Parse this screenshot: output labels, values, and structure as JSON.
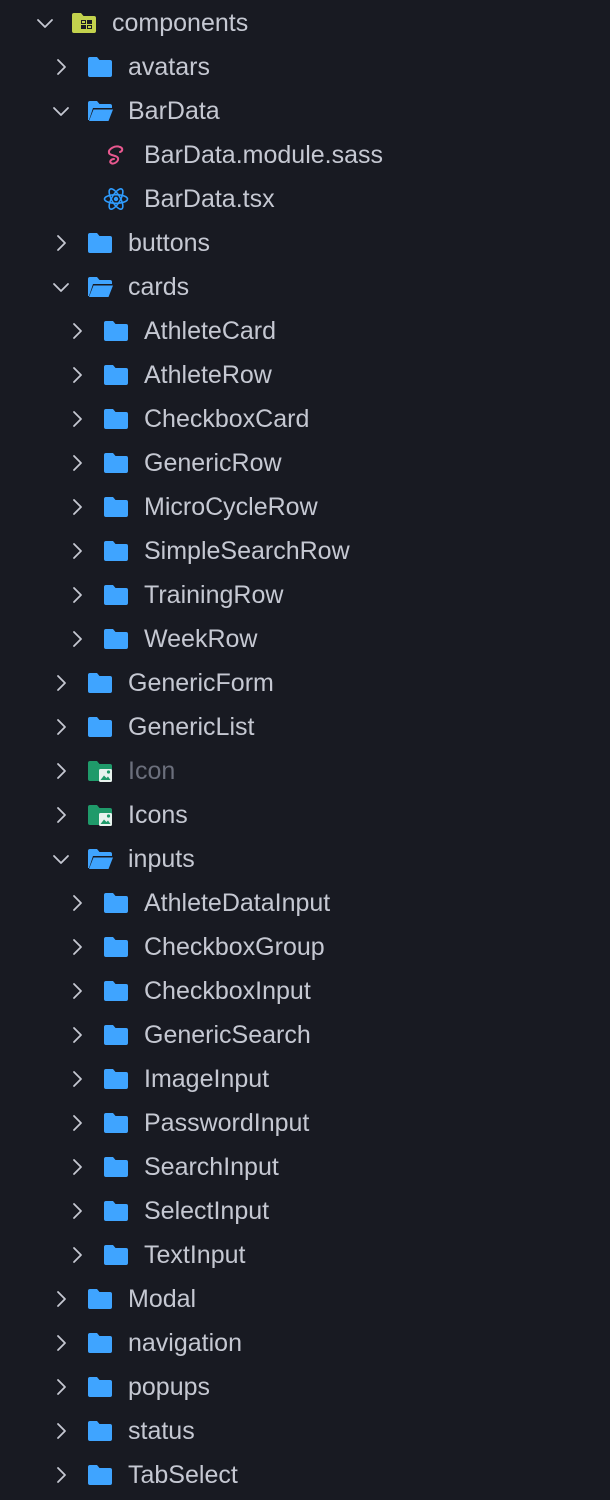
{
  "colors": {
    "background": "#181a22",
    "text": "#c5c8d2",
    "text_dimmed": "#6b6f7c",
    "chevron": "#c5c8d2",
    "folder": "#3fa4ff",
    "root_folder": "#c3d24d",
    "sass": "#e8588f",
    "react": "#2e9cff",
    "image_folder": "#1f9a6a"
  },
  "explorer": {
    "items": [
      {
        "label": "components",
        "depth": 0,
        "expanded": true,
        "icon": "root-folder-open-icon"
      },
      {
        "label": "avatars",
        "depth": 1,
        "expanded": false,
        "icon": "folder-icon"
      },
      {
        "label": "BarData",
        "depth": 1,
        "expanded": true,
        "icon": "folder-open-icon"
      },
      {
        "label": "BarData.module.sass",
        "depth": 2,
        "file": true,
        "icon": "sass-file-icon"
      },
      {
        "label": "BarData.tsx",
        "depth": 2,
        "file": true,
        "icon": "react-file-icon"
      },
      {
        "label": "buttons",
        "depth": 1,
        "expanded": false,
        "icon": "folder-icon"
      },
      {
        "label": "cards",
        "depth": 1,
        "expanded": true,
        "icon": "folder-open-icon"
      },
      {
        "label": "AthleteCard",
        "depth": 2,
        "expanded": false,
        "icon": "folder-icon"
      },
      {
        "label": "AthleteRow",
        "depth": 2,
        "expanded": false,
        "icon": "folder-icon"
      },
      {
        "label": "CheckboxCard",
        "depth": 2,
        "expanded": false,
        "icon": "folder-icon"
      },
      {
        "label": "GenericRow",
        "depth": 2,
        "expanded": false,
        "icon": "folder-icon"
      },
      {
        "label": "MicroCycleRow",
        "depth": 2,
        "expanded": false,
        "icon": "folder-icon"
      },
      {
        "label": "SimpleSearchRow",
        "depth": 2,
        "expanded": false,
        "icon": "folder-icon"
      },
      {
        "label": "TrainingRow",
        "depth": 2,
        "expanded": false,
        "icon": "folder-icon"
      },
      {
        "label": "WeekRow",
        "depth": 2,
        "expanded": false,
        "icon": "folder-icon"
      },
      {
        "label": "GenericForm",
        "depth": 1,
        "expanded": false,
        "icon": "folder-icon"
      },
      {
        "label": "GenericList",
        "depth": 1,
        "expanded": false,
        "icon": "folder-icon"
      },
      {
        "label": "Icon",
        "depth": 1,
        "expanded": false,
        "icon": "image-folder-icon",
        "dimmed": true
      },
      {
        "label": "Icons",
        "depth": 1,
        "expanded": false,
        "icon": "image-folder-icon"
      },
      {
        "label": "inputs",
        "depth": 1,
        "expanded": true,
        "icon": "folder-open-icon"
      },
      {
        "label": "AthleteDataInput",
        "depth": 2,
        "expanded": false,
        "icon": "folder-icon"
      },
      {
        "label": "CheckboxGroup",
        "depth": 2,
        "expanded": false,
        "icon": "folder-icon"
      },
      {
        "label": "CheckboxInput",
        "depth": 2,
        "expanded": false,
        "icon": "folder-icon"
      },
      {
        "label": "GenericSearch",
        "depth": 2,
        "expanded": false,
        "icon": "folder-icon"
      },
      {
        "label": "ImageInput",
        "depth": 2,
        "expanded": false,
        "icon": "folder-icon"
      },
      {
        "label": "PasswordInput",
        "depth": 2,
        "expanded": false,
        "icon": "folder-icon"
      },
      {
        "label": "SearchInput",
        "depth": 2,
        "expanded": false,
        "icon": "folder-icon"
      },
      {
        "label": "SelectInput",
        "depth": 2,
        "expanded": false,
        "icon": "folder-icon"
      },
      {
        "label": "TextInput",
        "depth": 2,
        "expanded": false,
        "icon": "folder-icon"
      },
      {
        "label": "Modal",
        "depth": 1,
        "expanded": false,
        "icon": "folder-icon"
      },
      {
        "label": "navigation",
        "depth": 1,
        "expanded": false,
        "icon": "folder-icon"
      },
      {
        "label": "popups",
        "depth": 1,
        "expanded": false,
        "icon": "folder-icon"
      },
      {
        "label": "status",
        "depth": 1,
        "expanded": false,
        "icon": "folder-icon"
      },
      {
        "label": "TabSelect",
        "depth": 1,
        "expanded": false,
        "icon": "folder-icon"
      }
    ]
  }
}
